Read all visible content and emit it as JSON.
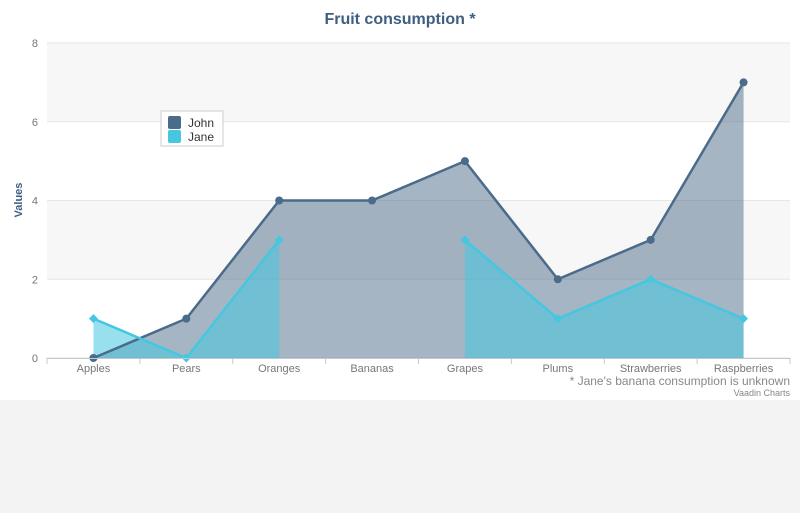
{
  "chart_data": {
    "type": "area",
    "title": "Fruit consumption *",
    "xlabel": "",
    "ylabel": "Values",
    "ylim": [
      0,
      8
    ],
    "yticks": [
      0,
      2,
      4,
      6,
      8
    ],
    "categories": [
      "Apples",
      "Pears",
      "Oranges",
      "Bananas",
      "Grapes",
      "Plums",
      "Strawberries",
      "Raspberries"
    ],
    "series": [
      {
        "name": "John",
        "values": [
          0,
          1,
          4,
          4,
          5,
          2,
          3,
          7
        ],
        "color": "#4b6b8a"
      },
      {
        "name": "Jane",
        "values": [
          1,
          0,
          3,
          null,
          3,
          1,
          2,
          1
        ],
        "color": "#45c7e0"
      }
    ],
    "legend_position": "top-left",
    "grid": true,
    "footnote": "* Jane's banana consumption is unknown",
    "credit": "Vaadin Charts"
  }
}
